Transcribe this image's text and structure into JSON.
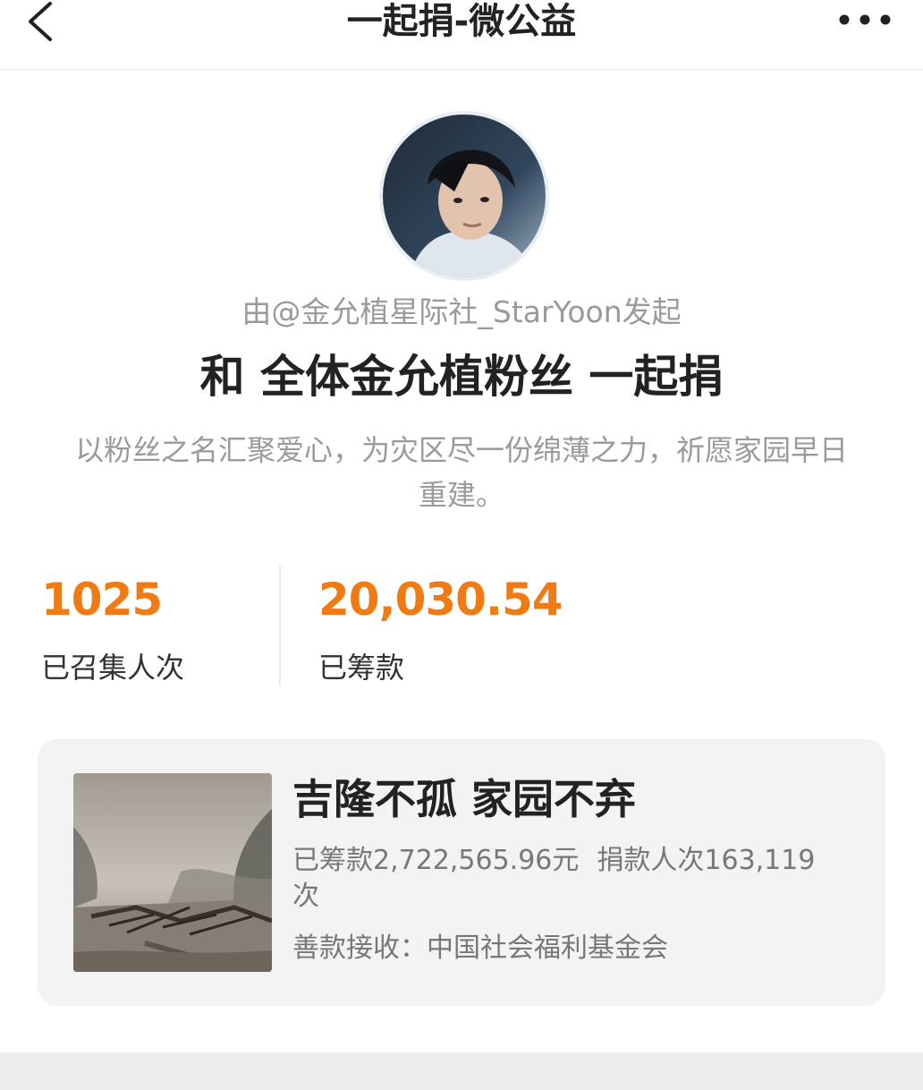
{
  "header": {
    "title": "一起捐-微公益",
    "back_icon": "chevron-left-icon",
    "more_icon": "more-dots-icon"
  },
  "initiator_text": "由@金允植星际社_StarYoon发起",
  "main_title": "和 全体金允植粉丝 一起捐",
  "description": "以粉丝之名汇聚爱心，为灾区尽一份绵薄之力，祈愿家园早日重建。",
  "stats": {
    "participants_value": "1025",
    "participants_label": "已召集人次",
    "raised_value": "20,030.54",
    "raised_label": "已筹款"
  },
  "campaign": {
    "title": "吉隆不孤 家园不弃",
    "raised_text": "已筹款2,722,565.96元",
    "donors_text": "捐款人次163,119次",
    "recipient_text": "善款接收：中国社会福利基金会"
  },
  "colors": {
    "accent": "#f07a14",
    "muted_text": "#9a9a9a",
    "card_bg": "#f3f3f3"
  }
}
